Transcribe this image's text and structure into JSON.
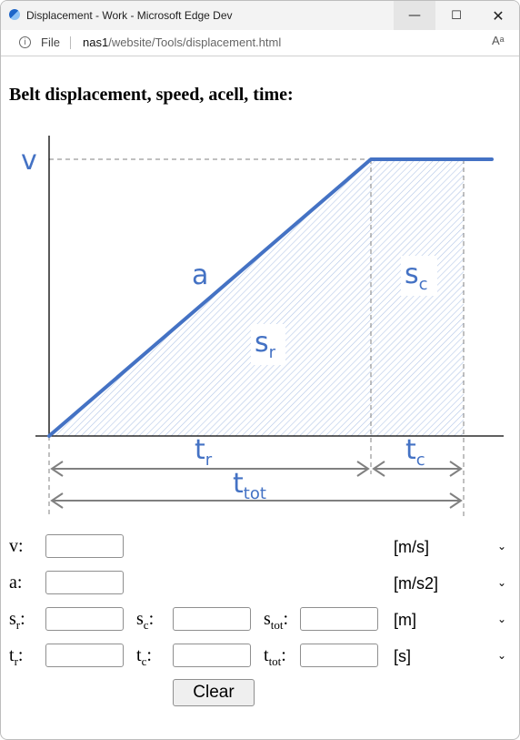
{
  "window": {
    "title": "Displacement - Work - Microsoft Edge Dev",
    "minimize_glyph": "—",
    "maximize_glyph": "☐",
    "close_glyph": "✕"
  },
  "address_bar": {
    "info_glyph": "i",
    "scheme_label": "File",
    "url_host": "nas1",
    "url_path": "/website/Tools/displacement.html",
    "read_aloud_glyph": "Aᵃ"
  },
  "page": {
    "heading": "Belt displacement, speed, acell, time:"
  },
  "diagram": {
    "label_v": "v",
    "label_a": "a",
    "label_sr": "s",
    "label_sr_sub": "r",
    "label_sc": "s",
    "label_sc_sub": "c",
    "label_tr": "t",
    "label_tr_sub": "r",
    "label_tc": "t",
    "label_tc_sub": "c",
    "label_ttot": "t",
    "label_ttot_sub": "tot",
    "colors": {
      "line": "#4472c4",
      "axis": "#000000",
      "dim": "#808080",
      "hatch": "#b4c7e7"
    }
  },
  "form": {
    "rows": [
      {
        "label": "v",
        "label_sub": "",
        "unit": "[m/s]"
      },
      {
        "label": "a",
        "label_sub": "",
        "unit": "[m/s2]"
      },
      {
        "label": "s",
        "label_sub": "r",
        "label2": "s",
        "label2_sub": "c",
        "label3": "s",
        "label3_sub": "tot",
        "unit": "[m]"
      },
      {
        "label": "t",
        "label_sub": "r",
        "label2": "t",
        "label2_sub": "c",
        "label3": "t",
        "label3_sub": "tot",
        "unit": "[s]"
      }
    ],
    "values": {
      "v": "",
      "a": "",
      "sr": "",
      "sc": "",
      "stot": "",
      "tr": "",
      "tc": "",
      "ttot": ""
    },
    "colon": ":",
    "chevron": "⌄",
    "clear_label": "Clear"
  }
}
